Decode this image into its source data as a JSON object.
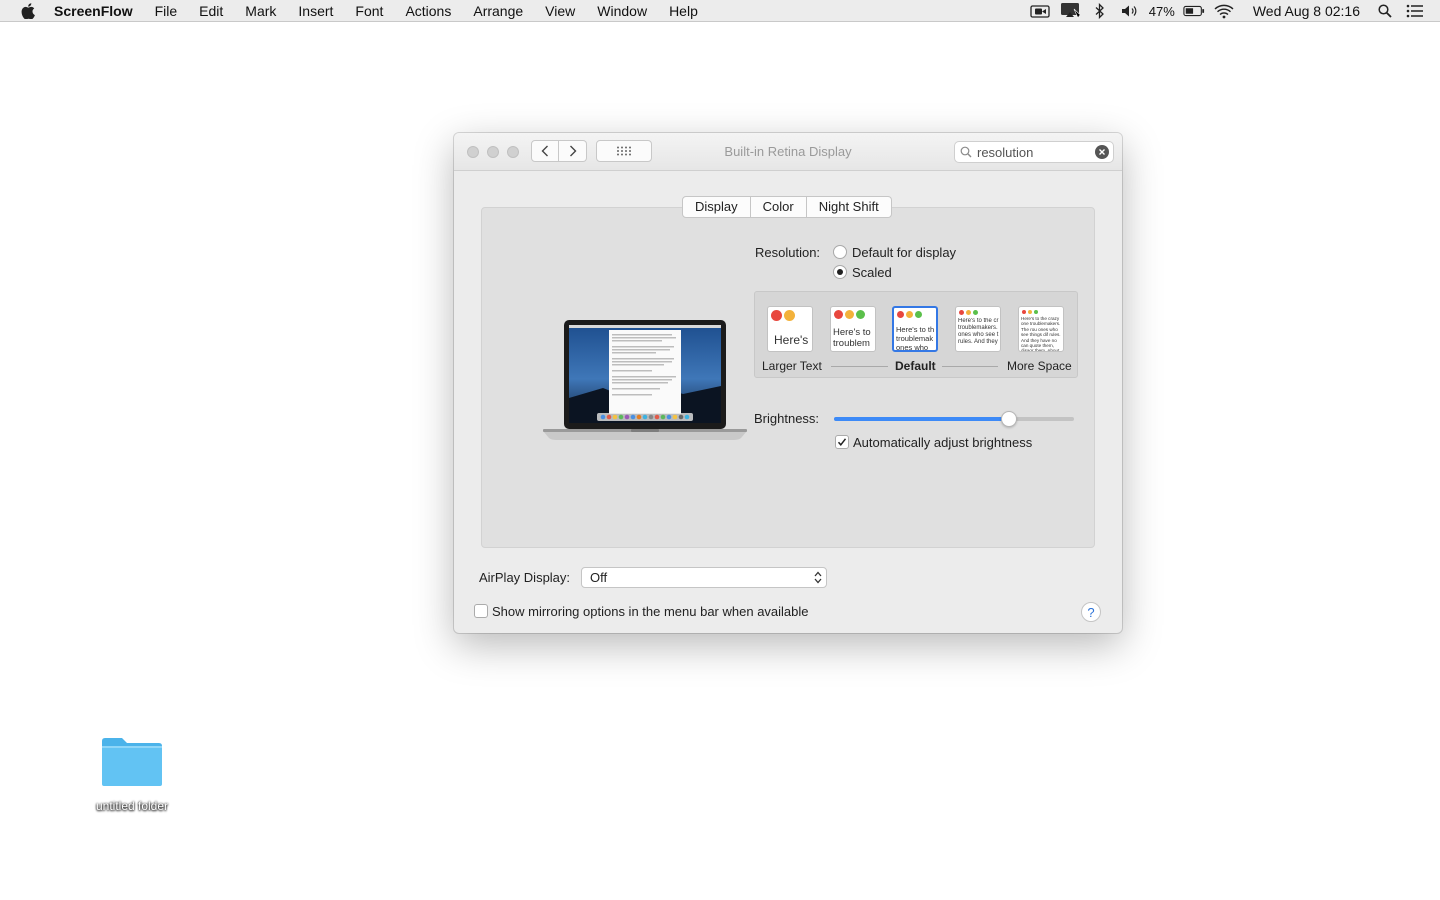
{
  "menubar": {
    "app_name": "ScreenFlow",
    "items": [
      "File",
      "Edit",
      "Mark",
      "Insert",
      "Font",
      "Actions",
      "Arrange",
      "View",
      "Window",
      "Help"
    ],
    "battery": "47%",
    "clock": "Wed Aug 8  02:16"
  },
  "window": {
    "title": "Built-in Retina Display",
    "search": {
      "value": "resolution"
    },
    "tabs": [
      "Display",
      "Color",
      "Night Shift"
    ],
    "resolution": {
      "label": "Resolution:",
      "options": [
        "Default for display",
        "Scaled"
      ],
      "selected": "Scaled"
    },
    "scaled": {
      "labels": {
        "left": "Larger Text",
        "middle": "Default",
        "right": "More Space"
      },
      "thumb_texts": [
        "Here's",
        "Here's to troublem",
        "Here's to th troublemak ones who",
        "Here's to the cr troublemakers. ones who see t rules. And they",
        "Here's to the crazy one troublemakers. The rou ones who see things dif rules. And they have no can quote them, disagr them. About the only th Because they change t"
      ],
      "selected_index": 2
    },
    "brightness": {
      "label": "Brightness:",
      "level_percent": 73,
      "auto_label": "Automatically adjust brightness",
      "auto_checked": true
    },
    "airplay": {
      "label": "AirPlay Display:",
      "value": "Off"
    },
    "mirroring": {
      "label": "Show mirroring options in the menu bar when available",
      "checked": false
    },
    "help": "?"
  },
  "desktop": {
    "folder_label": "untitled folder"
  },
  "colors": {
    "accent": "#3478e5",
    "folder": "#5fc2f2"
  }
}
